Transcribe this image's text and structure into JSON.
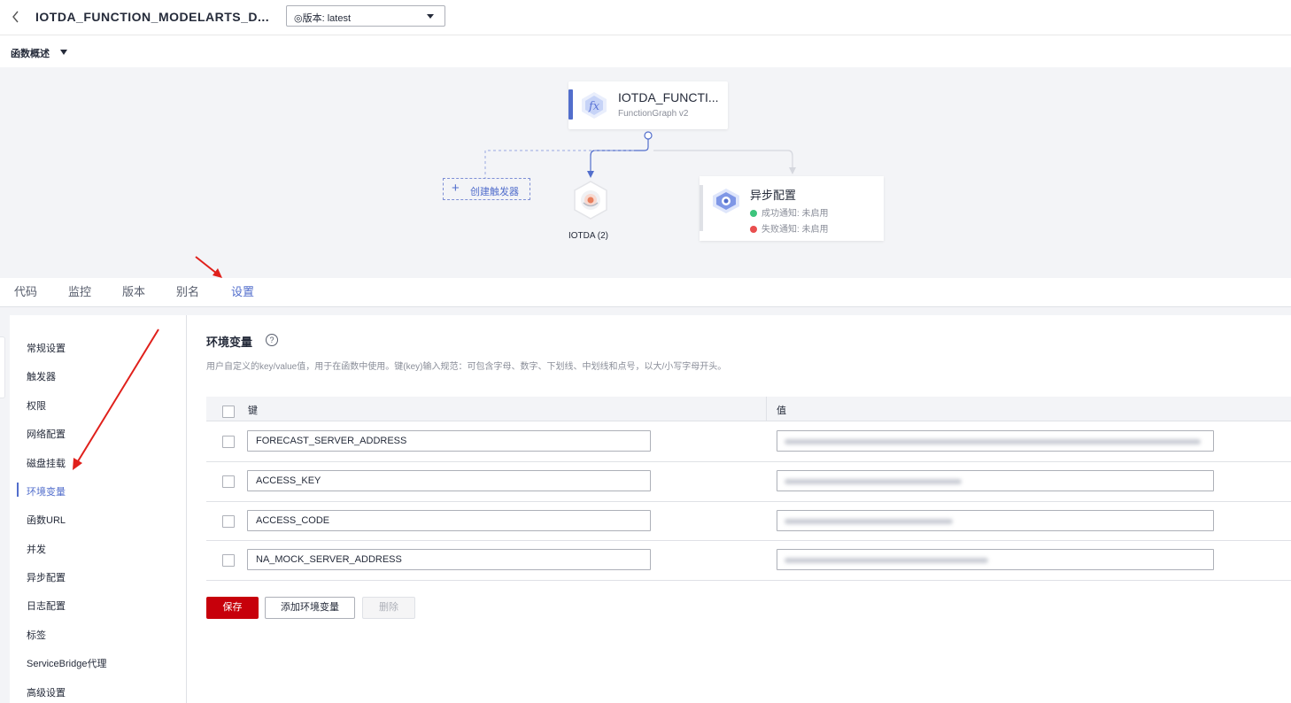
{
  "header": {
    "back_icon": "chevron-left-icon",
    "title": "IOTDA_FUNCTION_MODELARTS_D...",
    "version_select": "◎版本: latest"
  },
  "overview": {
    "label": "函数概述"
  },
  "flow": {
    "function_node": {
      "name": "IOTDA_FUNCTI...",
      "runtime": "FunctionGraph v2",
      "icon": "fx-function-icon"
    },
    "create_trigger": "创建触发器",
    "trigger_node": {
      "label": "IOTDA (2)",
      "icon": "iotda-icon"
    },
    "async_node": {
      "title": "异步配置",
      "success": "成功通知: 未启用",
      "failure": "失败通知: 未启用",
      "success_color": "#3cc47c",
      "failure_color": "#e94e4e"
    }
  },
  "tabs": [
    {
      "label": "代码"
    },
    {
      "label": "监控"
    },
    {
      "label": "版本"
    },
    {
      "label": "别名"
    },
    {
      "label": "设置"
    }
  ],
  "sidebar": {
    "items": [
      {
        "label": "常规设置"
      },
      {
        "label": "触发器"
      },
      {
        "label": "权限"
      },
      {
        "label": "网络配置"
      },
      {
        "label": "磁盘挂载"
      },
      {
        "label": "环境变量"
      },
      {
        "label": "函数URL"
      },
      {
        "label": "并发"
      },
      {
        "label": "异步配置"
      },
      {
        "label": "日志配置"
      },
      {
        "label": "标签"
      },
      {
        "label": "ServiceBridge代理"
      },
      {
        "label": "高级设置"
      }
    ],
    "active": "环境变量"
  },
  "env": {
    "title": "环境变量",
    "description": "用户自定义的key/value值，用于在函数中使用。键(key)输入规范：可包含字母、数字、下划线、中划线和点号，以大/小写字母开头。",
    "col_key": "键",
    "col_value": "值",
    "rows": [
      {
        "key": "FORECAST_SERVER_ADDRESS"
      },
      {
        "key": "ACCESS_KEY"
      },
      {
        "key": "ACCESS_CODE"
      },
      {
        "key": "NA_MOCK_SERVER_ADDRESS"
      }
    ]
  },
  "buttons": {
    "save": "保存",
    "add": "添加环境变量",
    "delete": "删除"
  },
  "colors": {
    "accent": "#526ecc",
    "primary_button": "#c7000b",
    "annotation_arrow": "#e0201b"
  }
}
